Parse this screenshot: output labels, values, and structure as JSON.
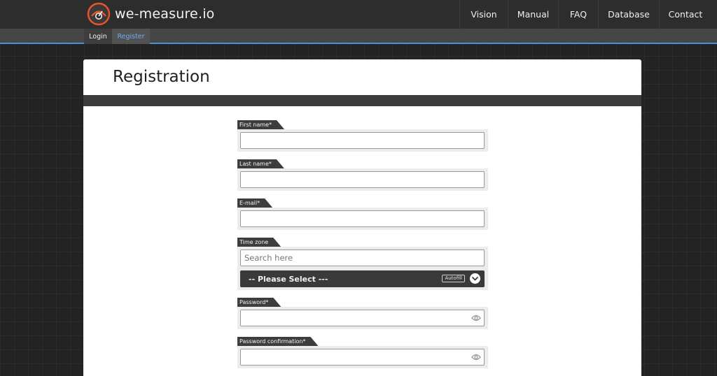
{
  "brand": {
    "name": "we-measure.io",
    "accent": "#e8552b"
  },
  "nav": {
    "items": [
      {
        "id": "vision",
        "label": "Vision"
      },
      {
        "id": "manual",
        "label": "Manual"
      },
      {
        "id": "faq",
        "label": "FAQ"
      },
      {
        "id": "database",
        "label": "Database"
      },
      {
        "id": "contact",
        "label": "Contact"
      }
    ]
  },
  "subnav": {
    "login": "Login",
    "register": "Register",
    "active": "register",
    "active_color": "#4a90d9"
  },
  "page": {
    "title": "Registration"
  },
  "form": {
    "first_name": {
      "label": "First name*",
      "value": ""
    },
    "last_name": {
      "label": "Last name*",
      "value": ""
    },
    "email": {
      "label": "E-mail*",
      "value": ""
    },
    "timezone": {
      "label": "Time zone",
      "search_placeholder": "Search here",
      "selected": "-- Please Select ---",
      "autofill": "Autofill"
    },
    "password": {
      "label": "Password*",
      "value": ""
    },
    "password_confirmation": {
      "label": "Password confirmation*",
      "value": ""
    }
  },
  "icons": {
    "logo": "gauge-eye-logo-icon",
    "password_toggle": "eye-icon",
    "select_toggle": "chevron-down-icon"
  }
}
